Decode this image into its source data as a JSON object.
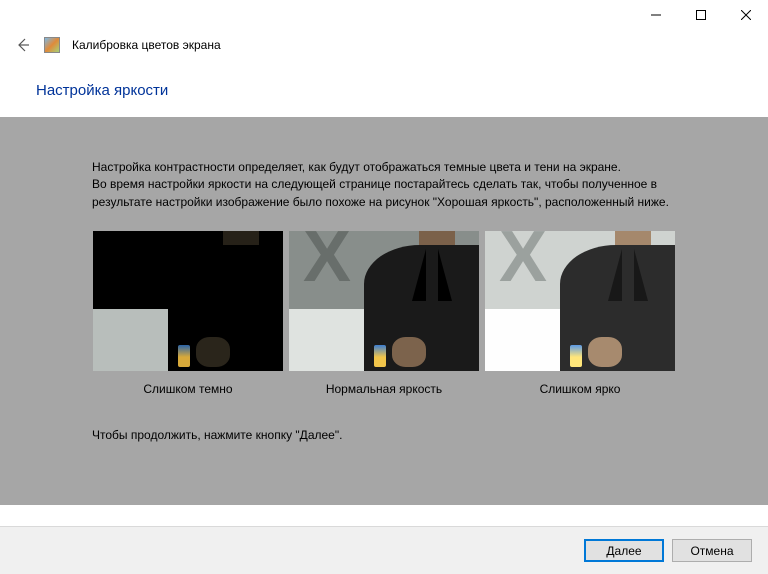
{
  "window": {
    "app_title": "Калибровка цветов экрана"
  },
  "heading": "Настройка яркости",
  "description": {
    "line1": "Настройка контрастности определяет, как будут отображаться темные цвета и тени на экране.",
    "line2": "Во время настройки яркости на следующей странице постарайтесь сделать так, чтобы полученное в результате настройки изображение было похоже на рисунок \"Хорошая яркость\", расположенный ниже."
  },
  "samples": [
    {
      "caption": "Слишком темно"
    },
    {
      "caption": "Нормальная яркость"
    },
    {
      "caption": "Слишком ярко"
    }
  ],
  "footnote": "Чтобы продолжить, нажмите кнопку \"Далее\".",
  "buttons": {
    "next": "Далее",
    "cancel": "Отмена"
  }
}
